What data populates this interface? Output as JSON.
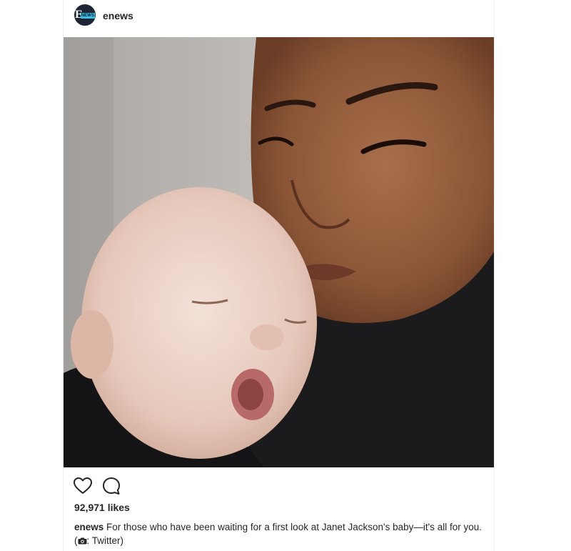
{
  "post": {
    "author": {
      "username": "enews",
      "avatar_icon": "enews-logo-icon",
      "avatar_letter": "E",
      "avatar_tag": "NEWS"
    },
    "photo": {
      "subject_icon": "post-photo"
    },
    "actions": {
      "like_icon": "heart-outline-icon",
      "comment_icon": "comment-bubble-icon"
    },
    "likes_text": "92,971 likes",
    "caption": {
      "username": "enews",
      "text_before": "For those who have been waiting for a first look at Janet Jackson's baby—it's all for you. (",
      "camera_icon": "camera-icon",
      "text_after": ": Twitter)"
    }
  },
  "colors": {
    "text": "#262626",
    "border": "#ededed",
    "avatar_bg": "#1d2433",
    "avatar_accent": "#36c0e8"
  }
}
